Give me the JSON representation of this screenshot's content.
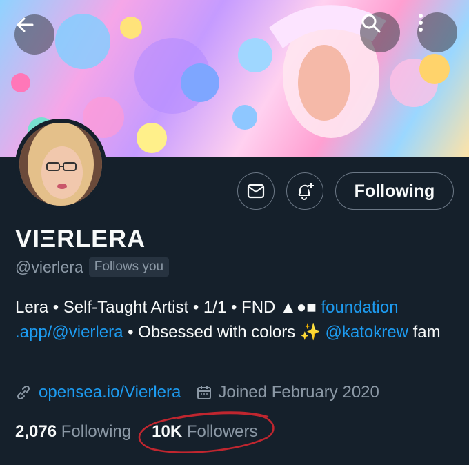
{
  "header": {
    "back_icon": "back-arrow-icon",
    "search_icon": "search-icon",
    "more_icon": "more-vertical-icon"
  },
  "profile": {
    "display_name": "VIΞRLERA",
    "handle": "@vierlera",
    "follows_you": "Follows you",
    "following_button": "Following",
    "message_icon": "mail-icon",
    "notify_icon": "bell-plus-icon"
  },
  "bio": {
    "part1": "Lera • Self-Taught Artist • 1/1 • FND ▲●■ ",
    "link1": "foundation .app/@vierlera",
    "part2": " • Obsessed with colors ✨ ",
    "mention": "@katokrew",
    "part3": " fam"
  },
  "meta": {
    "website": "opensea.io/Vierlera",
    "joined": "Joined February 2020"
  },
  "stats": {
    "following_count": "2,076",
    "following_label": "Following",
    "followers_count": "10K",
    "followers_label": "Followers"
  },
  "colors": {
    "background": "#15202b",
    "link": "#1d9bf0",
    "muted": "#8b98a5",
    "annotation": "#c0262f"
  }
}
